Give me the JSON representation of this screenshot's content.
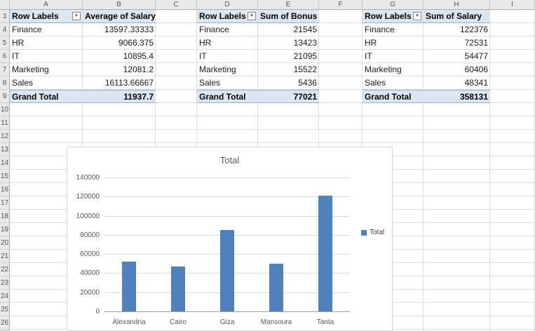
{
  "icons": {
    "filter_dropdown": "▾"
  },
  "spreadsheet": {
    "column_headers": [
      "A",
      "B",
      "C",
      "D",
      "E",
      "F",
      "G",
      "H",
      "I"
    ],
    "row_numbers": [
      "3",
      "4",
      "5",
      "6",
      "7",
      "8",
      "9",
      "10",
      "11",
      "12",
      "13",
      "14",
      "15",
      "16",
      "17",
      "18",
      "19",
      "20",
      "21",
      "22",
      "23",
      "24",
      "25",
      "26"
    ]
  },
  "pivots": [
    {
      "row_label_header": "Row Labels",
      "value_header": "Average of Salary",
      "rows": [
        {
          "label": "Finance",
          "value": "13597.33333"
        },
        {
          "label": "HR",
          "value": "9066.375"
        },
        {
          "label": "IT",
          "value": "10895.4"
        },
        {
          "label": "Marketing",
          "value": "12081.2"
        },
        {
          "label": "Sales",
          "value": "16113.66667"
        }
      ],
      "total_label": "Grand Total",
      "total_value": "11937.7"
    },
    {
      "row_label_header": "Row Labels",
      "value_header": "Sum of Bonus",
      "rows": [
        {
          "label": "Finance",
          "value": "21545"
        },
        {
          "label": "HR",
          "value": "13423"
        },
        {
          "label": "IT",
          "value": "21095"
        },
        {
          "label": "Marketing",
          "value": "15522"
        },
        {
          "label": "Sales",
          "value": "5436"
        }
      ],
      "total_label": "Grand Total",
      "total_value": "77021"
    },
    {
      "row_label_header": "Row Labels",
      "value_header": "Sum of Salary",
      "rows": [
        {
          "label": "Finance",
          "value": "122376"
        },
        {
          "label": "HR",
          "value": "72531"
        },
        {
          "label": "IT",
          "value": "54477"
        },
        {
          "label": "Marketing",
          "value": "60406"
        },
        {
          "label": "Sales",
          "value": "48341"
        }
      ],
      "total_label": "Grand Total",
      "total_value": "358131"
    }
  ],
  "chart_data": {
    "type": "bar",
    "title": "Total",
    "categories": [
      "Alexandria",
      "Cairo",
      "Giza",
      "Mansoura",
      "Tanta"
    ],
    "values": [
      52000,
      47000,
      85000,
      50000,
      121000
    ],
    "ylim": [
      0,
      140000
    ],
    "ytick_interval": 20000,
    "grid": true,
    "legend_label": "Total",
    "legend_position": "right",
    "bar_color": "#4f81bd"
  }
}
